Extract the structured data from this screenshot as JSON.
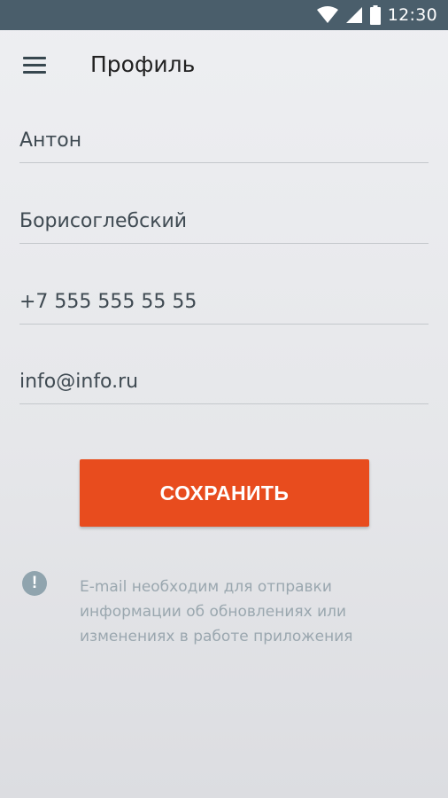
{
  "status_bar": {
    "time": "12:30",
    "icons": [
      "wifi-icon",
      "signal-icon",
      "battery-icon"
    ]
  },
  "app_bar": {
    "title": "Профиль",
    "menu_icon": "menu-icon"
  },
  "form": {
    "first_name": "Антон",
    "last_name": "Борисоглебский",
    "phone": "+7 555 555 55 55",
    "email": "info@info.ru"
  },
  "save_button": {
    "label": "СОХРАНИТЬ",
    "color": "#e84c1e"
  },
  "info_note": {
    "icon": "info-exclamation-icon",
    "text": "E-mail необходим для отправки информации об обновлениях или изменениях в работе приложения"
  },
  "colors": {
    "status_bar": "#4a5e6b",
    "accent": "#e84c1e",
    "hint_text": "#9aa7af"
  }
}
